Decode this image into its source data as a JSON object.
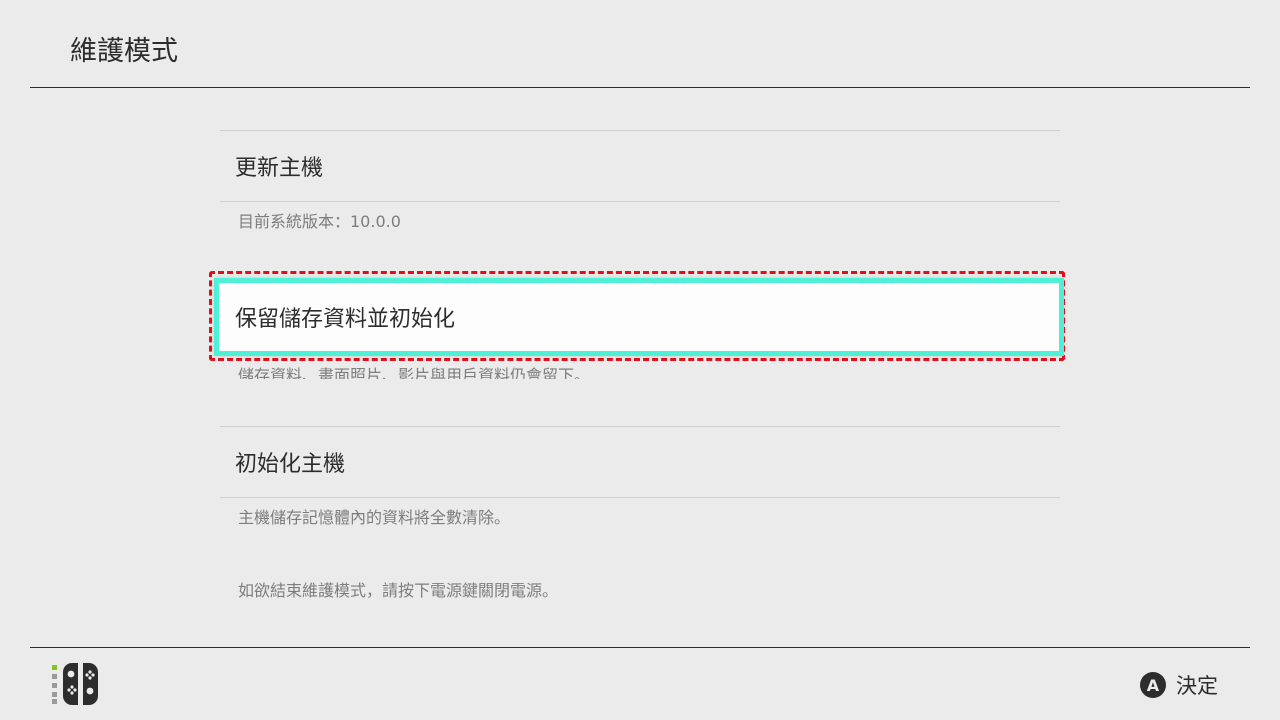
{
  "header": {
    "title": "維護模式"
  },
  "menu": {
    "items": [
      {
        "label": "更新主機",
        "description": "目前系統版本：10.0.0"
      },
      {
        "label": "保留儲存資料並初始化",
        "description": "儲存資料、畫面照片、影片與用戶資料仍會留下。",
        "selected": true
      },
      {
        "label": "初始化主機",
        "description": "主機儲存記憶體內的資料將全數清除。"
      }
    ],
    "exit_note": "如欲結束維護模式，請按下電源鍵關閉電源。"
  },
  "footer": {
    "button_glyph": "A",
    "action_label": "決定",
    "controller_icon": "joycon-controller-icon"
  },
  "colors": {
    "background": "#ebebeb",
    "selection_border": "#4ef0d6",
    "highlight_dashed": "#e0101a",
    "text": "#2d2d2d",
    "subtext": "#7d7d7d"
  }
}
